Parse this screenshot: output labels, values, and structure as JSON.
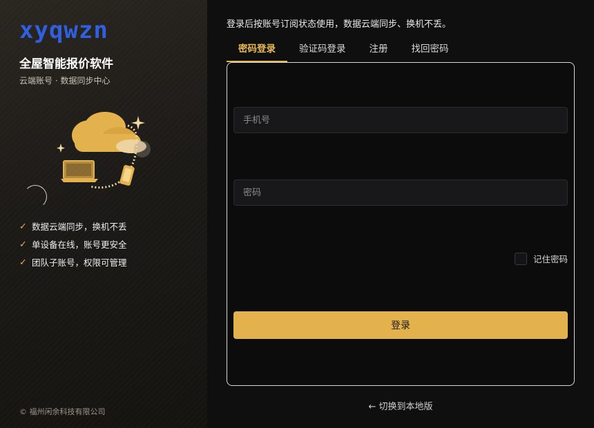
{
  "brand": {
    "logo": "xyqwzn",
    "title": "全屋智能报价软件",
    "subtitle": "云端账号 · 数据同步中心"
  },
  "features": [
    "数据云端同步，换机不丢",
    "单设备在线，账号更安全",
    "团队子账号，权限可管理"
  ],
  "copyright": "© 福州闲余科技有限公司",
  "notice": "登录后按账号订阅状态使用，数据云端同步、换机不丢。",
  "tabs": [
    "密码登录",
    "验证码登录",
    "注册",
    "找回密码"
  ],
  "form": {
    "phone_placeholder": "手机号",
    "password_placeholder": "密码",
    "remember_label": "记住密码",
    "remember_checked": false,
    "login_label": "登录"
  },
  "switch_label": "← 切换到本地版",
  "colors": {
    "accent": "#e4b24c",
    "logo": "#2f5ee0",
    "background": "#0f0f10"
  }
}
